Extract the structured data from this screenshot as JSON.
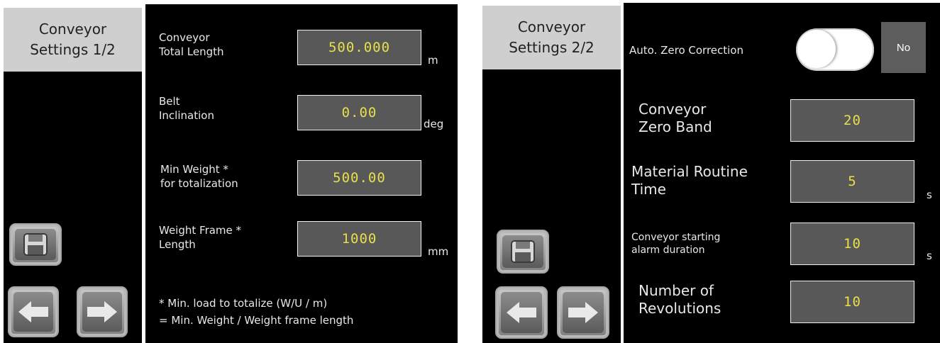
{
  "screen1": {
    "title": "Conveyor Settings 1/2",
    "fields": [
      {
        "label_line1": "Conveyor",
        "label_line2": "Total Length",
        "value": "500.000",
        "unit": "m"
      },
      {
        "label_line1": "Belt",
        "label_line2": "Inclination",
        "value": "0.00",
        "unit": "deg"
      },
      {
        "label_line1": "Min Weight *",
        "label_line2": "for totalization",
        "value": "500.00",
        "unit": ""
      },
      {
        "label_line1": "Weight Frame *",
        "label_line2": "Length",
        "value": "1000",
        "unit": "mm"
      }
    ],
    "note_line1": "* Min. load to totalize (W/U / m)",
    "note_line2": "= Min. Weight / Weight frame length"
  },
  "screen2": {
    "title": "Conveyor Settings 2/2",
    "auto_zero_label": "Auto. Zero Correction",
    "auto_zero_state": "No",
    "fields": [
      {
        "label_line1": "Conveyor",
        "label_line2": "Zero Band",
        "value": "20",
        "unit": ""
      },
      {
        "label_line1": "Material Routine",
        "label_line2": "Time",
        "value": "5",
        "unit": "s"
      },
      {
        "label_line1": "Conveyor starting",
        "label_line2": "alarm duration",
        "value": "10",
        "unit": "s"
      },
      {
        "label_line1": "Number of",
        "label_line2": "Revolutions",
        "value": "10",
        "unit": ""
      }
    ]
  },
  "icons": {
    "save": "floppy-disk-icon",
    "prev": "arrow-left-icon",
    "next": "arrow-right-icon"
  },
  "colors": {
    "background": "#000000",
    "field_bg": "#585858",
    "field_text": "#e7e04a",
    "tab_bg": "#cfcfcf"
  }
}
